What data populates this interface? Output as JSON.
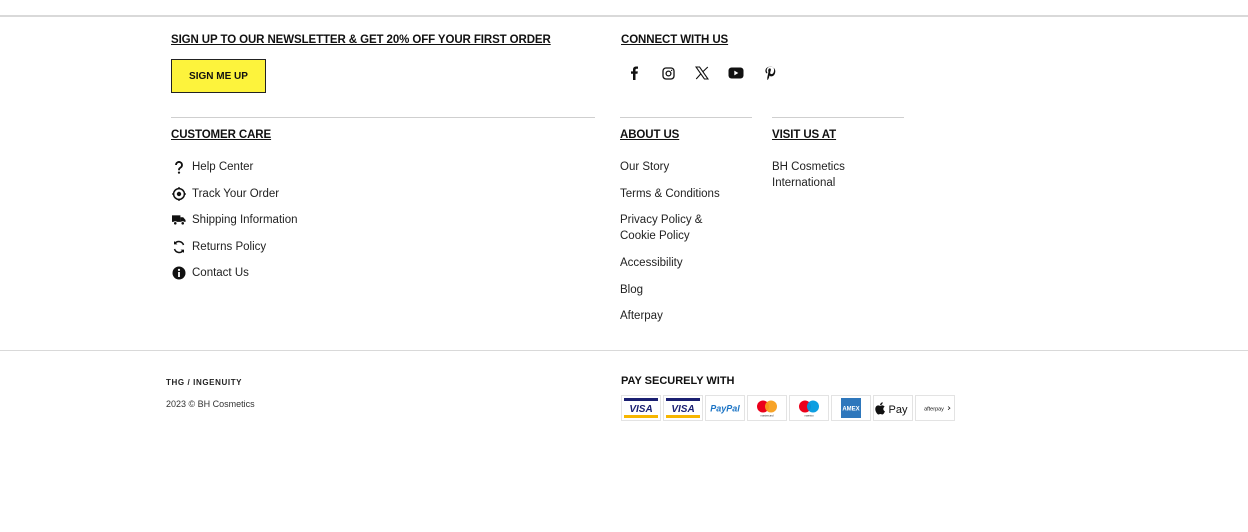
{
  "newsletter": {
    "heading": "SIGN UP TO OUR NEWSLETTER & GET 20% OFF YOUR FIRST ORDER",
    "button_label": "SIGN ME UP",
    "button_color": "#fdf33c"
  },
  "connect": {
    "heading": "CONNECT WITH US",
    "icons": [
      "facebook-icon",
      "instagram-icon",
      "x-twitter-icon",
      "youtube-icon",
      "pinterest-icon"
    ]
  },
  "customer_care": {
    "heading": "CUSTOMER CARE",
    "items": [
      {
        "label": "Help Center",
        "icon": "question-icon"
      },
      {
        "label": "Track Your Order",
        "icon": "target-icon"
      },
      {
        "label": "Shipping Information",
        "icon": "truck-icon"
      },
      {
        "label": "Returns Policy",
        "icon": "refresh-icon"
      },
      {
        "label": "Contact Us",
        "icon": "info-icon"
      }
    ]
  },
  "about": {
    "heading": "ABOUT US",
    "items": [
      {
        "label": "Our Story"
      },
      {
        "label": "Terms & Conditions"
      },
      {
        "label_line1": "Privacy Policy &",
        "label_line2": "Cookie Policy"
      },
      {
        "label": "Accessibility"
      },
      {
        "label": "Blog"
      },
      {
        "label": "Afterpay"
      }
    ]
  },
  "visit": {
    "heading": "VISIT US AT",
    "line1": "BH Cosmetics",
    "line2": "International"
  },
  "footer": {
    "brand": "THG / INGENUITY",
    "copyright": "2023 © BH Cosmetics",
    "pay_heading": "PAY SECURELY WITH",
    "payment_methods": [
      "VISA",
      "VISA",
      "PayPal",
      "mastercard",
      "maestro",
      "AMEX",
      "Pay",
      "afterpay"
    ]
  }
}
